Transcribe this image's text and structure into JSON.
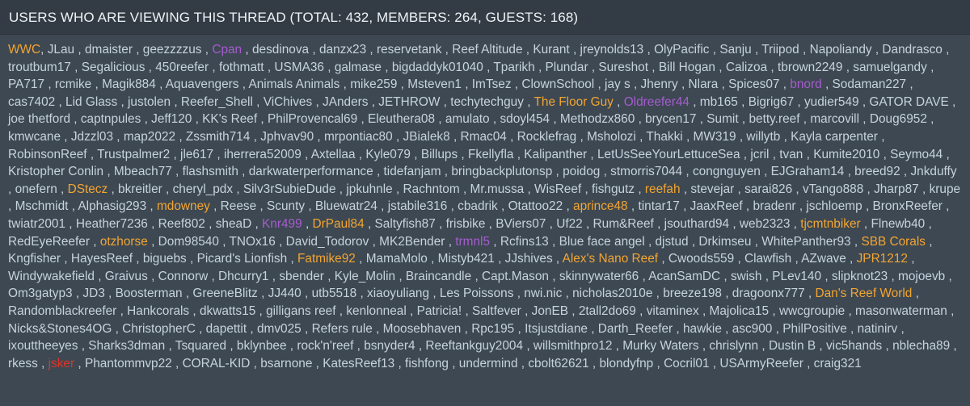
{
  "header": {
    "title": "USERS WHO ARE VIEWING THIS THREAD (TOTAL: 432, MEMBERS: 264, GUESTS: 168)"
  },
  "colors": {
    "default": "#c6d3dd",
    "orange": "#f3a532",
    "purple": "#a65ccf",
    "red": "#e0342a"
  },
  "users": [
    {
      "name": "WWC",
      "role": "orange"
    },
    {
      "name": "JLau"
    },
    {
      "name": "dmaister"
    },
    {
      "name": "geezzzzus"
    },
    {
      "name": "Cpan",
      "role": "purple"
    },
    {
      "name": "desdinova"
    },
    {
      "name": "danzx23"
    },
    {
      "name": "reservetank"
    },
    {
      "name": "Reef Altitude"
    },
    {
      "name": "Kurant"
    },
    {
      "name": "jreynolds13"
    },
    {
      "name": "OlyPacific"
    },
    {
      "name": "Sanju"
    },
    {
      "name": "Triipod"
    },
    {
      "name": "Napoliandy"
    },
    {
      "name": "Dandrasco"
    },
    {
      "name": "troutbum17"
    },
    {
      "name": "Segalicious"
    },
    {
      "name": "450reefer"
    },
    {
      "name": "fothmatt"
    },
    {
      "name": "USMA36"
    },
    {
      "name": "galmase"
    },
    {
      "name": "bigdaddyk01040"
    },
    {
      "name": "Tparikh"
    },
    {
      "name": "Plundar"
    },
    {
      "name": "Sureshot"
    },
    {
      "name": "Bill Hogan"
    },
    {
      "name": "Calizoa"
    },
    {
      "name": "tbrown2249"
    },
    {
      "name": "samuelgandy"
    },
    {
      "name": "PA717"
    },
    {
      "name": "rcmike"
    },
    {
      "name": "Magik884"
    },
    {
      "name": "Aquavengers"
    },
    {
      "name": "Animals Animals"
    },
    {
      "name": "mike259"
    },
    {
      "name": "Msteven1"
    },
    {
      "name": "ImTsez"
    },
    {
      "name": "ClownSchool"
    },
    {
      "name": "jay s"
    },
    {
      "name": "Jhenry"
    },
    {
      "name": "Nlara"
    },
    {
      "name": "Spices07"
    },
    {
      "name": "bnord",
      "role": "purple"
    },
    {
      "name": "Sodaman227"
    },
    {
      "name": "cas7402"
    },
    {
      "name": "Lid Glass"
    },
    {
      "name": "justolen"
    },
    {
      "name": "Reefer_Shell"
    },
    {
      "name": "ViChives"
    },
    {
      "name": "JAnders"
    },
    {
      "name": "JETHROW"
    },
    {
      "name": "techytechguy"
    },
    {
      "name": "The Floor Guy",
      "role": "orange"
    },
    {
      "name": "Oldreefer44",
      "role": "purple"
    },
    {
      "name": "mb165"
    },
    {
      "name": "Bigrig67"
    },
    {
      "name": "yudier549"
    },
    {
      "name": "GATOR DAVE"
    },
    {
      "name": "joe thetford"
    },
    {
      "name": "captnpules"
    },
    {
      "name": "Jeff120"
    },
    {
      "name": "KK's Reef"
    },
    {
      "name": "PhilProvencal69"
    },
    {
      "name": "Eleuthera08"
    },
    {
      "name": "amulato"
    },
    {
      "name": "sdoyl454"
    },
    {
      "name": "Methodzx860"
    },
    {
      "name": "brycen17"
    },
    {
      "name": "Sumit"
    },
    {
      "name": "betty.reef"
    },
    {
      "name": "marcovill"
    },
    {
      "name": "Doug6952"
    },
    {
      "name": "kmwcane"
    },
    {
      "name": "Jdzzl03"
    },
    {
      "name": "map2022"
    },
    {
      "name": "Zssmith714"
    },
    {
      "name": "Jphvav90"
    },
    {
      "name": "mrpontiac80"
    },
    {
      "name": "JBialek8"
    },
    {
      "name": "Rmac04"
    },
    {
      "name": "Rocklefrag"
    },
    {
      "name": "Msholozi"
    },
    {
      "name": "Thakki"
    },
    {
      "name": "MW319"
    },
    {
      "name": "willytb"
    },
    {
      "name": "Kayla carpenter"
    },
    {
      "name": "RobinsonReef"
    },
    {
      "name": "Trustpalmer2"
    },
    {
      "name": "jle617"
    },
    {
      "name": "iherrera52009"
    },
    {
      "name": "Axtellaa"
    },
    {
      "name": "Kyle079"
    },
    {
      "name": "Billups"
    },
    {
      "name": "Fkellyfla"
    },
    {
      "name": "Kalipanther"
    },
    {
      "name": "LetUsSeeYourLettuceSea"
    },
    {
      "name": "jcril"
    },
    {
      "name": "tvan"
    },
    {
      "name": "Kumite2010"
    },
    {
      "name": "Seymo44"
    },
    {
      "name": "Kristopher Conlin"
    },
    {
      "name": "Mbeach77"
    },
    {
      "name": "flashsmith"
    },
    {
      "name": "darkwaterperformance"
    },
    {
      "name": "tidefanjam"
    },
    {
      "name": "bringbackplutonsp"
    },
    {
      "name": "poidog"
    },
    {
      "name": "stmorris7044"
    },
    {
      "name": "congnguyen"
    },
    {
      "name": "EJGraham14"
    },
    {
      "name": "breed92"
    },
    {
      "name": "Jnkduffy"
    },
    {
      "name": "onefern"
    },
    {
      "name": "DStecz",
      "role": "orange"
    },
    {
      "name": "bkreitler"
    },
    {
      "name": "cheryl_pdx"
    },
    {
      "name": "Silv3rSubieDude"
    },
    {
      "name": "jpkuhnle"
    },
    {
      "name": "Rachntom"
    },
    {
      "name": "Mr.mussa"
    },
    {
      "name": "WisReef"
    },
    {
      "name": "fishgutz"
    },
    {
      "name": "reefah",
      "role": "orange"
    },
    {
      "name": "stevejar"
    },
    {
      "name": "sarai826"
    },
    {
      "name": "vTango888"
    },
    {
      "name": "Jharp87"
    },
    {
      "name": "krupe"
    },
    {
      "name": "Mschmidt"
    },
    {
      "name": "Alphasig293"
    },
    {
      "name": "mdowney",
      "role": "orange"
    },
    {
      "name": "Reese"
    },
    {
      "name": "Scunty"
    },
    {
      "name": "Bluewatr24"
    },
    {
      "name": "jstabile316"
    },
    {
      "name": "cbadrik"
    },
    {
      "name": "Otattoo22"
    },
    {
      "name": "aprince48",
      "role": "orange"
    },
    {
      "name": "tintar17"
    },
    {
      "name": "JaaxReef"
    },
    {
      "name": "bradenr"
    },
    {
      "name": "jschloemp"
    },
    {
      "name": "BronxReefer"
    },
    {
      "name": "twiatr2001"
    },
    {
      "name": "Heather7236"
    },
    {
      "name": "Reef802"
    },
    {
      "name": "sheaD"
    },
    {
      "name": "Knr499",
      "role": "purple"
    },
    {
      "name": "DrPaul84",
      "role": "orange"
    },
    {
      "name": "Saltyfish87"
    },
    {
      "name": "frisbike"
    },
    {
      "name": "BViers07"
    },
    {
      "name": "Uf22"
    },
    {
      "name": "Rum&Reef"
    },
    {
      "name": "jsouthard94"
    },
    {
      "name": "web2323"
    },
    {
      "name": "tjcmtnbiker",
      "role": "orange"
    },
    {
      "name": "Flnewb40"
    },
    {
      "name": "RedEyeReefer"
    },
    {
      "name": "otzhorse",
      "role": "orange"
    },
    {
      "name": "Dom98540"
    },
    {
      "name": "TNOx16"
    },
    {
      "name": "David_Todorov"
    },
    {
      "name": "MK2Bender"
    },
    {
      "name": "trmnl5",
      "role": "purple"
    },
    {
      "name": "Rcfins13"
    },
    {
      "name": "Blue face angel"
    },
    {
      "name": "djstud"
    },
    {
      "name": "Drkimseu"
    },
    {
      "name": "WhitePanther93"
    },
    {
      "name": "SBB Corals",
      "role": "orange"
    },
    {
      "name": "Kngfisher"
    },
    {
      "name": "HayesReef"
    },
    {
      "name": "biguebs"
    },
    {
      "name": "Picard's Lionfish"
    },
    {
      "name": "Fatmike92",
      "role": "orange"
    },
    {
      "name": "MamaMolo"
    },
    {
      "name": "Mistyb421"
    },
    {
      "name": "JJshives"
    },
    {
      "name": "Alex's Nano Reef",
      "role": "orange"
    },
    {
      "name": "Cwoods559"
    },
    {
      "name": "Clawfish"
    },
    {
      "name": "AZwave"
    },
    {
      "name": "JPR1212",
      "role": "orange"
    },
    {
      "name": "Windywakefield"
    },
    {
      "name": "Graivus"
    },
    {
      "name": "Connorw"
    },
    {
      "name": "Dhcurry1"
    },
    {
      "name": "sbender"
    },
    {
      "name": "Kyle_Molin"
    },
    {
      "name": "Braincandle"
    },
    {
      "name": "Capt.Mason"
    },
    {
      "name": "skinnywater66"
    },
    {
      "name": "AcanSamDC"
    },
    {
      "name": "swish"
    },
    {
      "name": "PLev140"
    },
    {
      "name": "slipknot23"
    },
    {
      "name": "mojoevb"
    },
    {
      "name": "Om3gatyp3"
    },
    {
      "name": "JD3"
    },
    {
      "name": "Boosterman"
    },
    {
      "name": "GreeneBlitz"
    },
    {
      "name": "JJ440"
    },
    {
      "name": "utb5518"
    },
    {
      "name": "xiaoyuliang"
    },
    {
      "name": "Les Poissons"
    },
    {
      "name": "nwi.nic"
    },
    {
      "name": "nicholas2010e"
    },
    {
      "name": "breeze198"
    },
    {
      "name": "dragoonx777"
    },
    {
      "name": "Dan's Reef World",
      "role": "orange"
    },
    {
      "name": "Randomblackreefer"
    },
    {
      "name": "Hankcorals"
    },
    {
      "name": "dkwatts15"
    },
    {
      "name": "gilligans reef"
    },
    {
      "name": "kenlonneal"
    },
    {
      "name": "Patricia!"
    },
    {
      "name": "Saltfever"
    },
    {
      "name": "JonEB"
    },
    {
      "name": "2tall2do69"
    },
    {
      "name": "vitaminex"
    },
    {
      "name": "Majolica15"
    },
    {
      "name": "wwcgroupie"
    },
    {
      "name": "masonwaterman"
    },
    {
      "name": "Nicks&Stones4OG"
    },
    {
      "name": "ChristopherC"
    },
    {
      "name": "dapettit"
    },
    {
      "name": "dmv025"
    },
    {
      "name": "Refers rule"
    },
    {
      "name": "Moosebhaven"
    },
    {
      "name": "Rpc195"
    },
    {
      "name": "Itsjustdiane"
    },
    {
      "name": "Darth_Reefer"
    },
    {
      "name": "hawkie"
    },
    {
      "name": "asc900"
    },
    {
      "name": "PhilPositive"
    },
    {
      "name": "natinirv"
    },
    {
      "name": "ixouttheeyes"
    },
    {
      "name": "Sharks3dman"
    },
    {
      "name": "Tsquared"
    },
    {
      "name": "bklynbee"
    },
    {
      "name": "rock'n'reef"
    },
    {
      "name": "bsnyder4"
    },
    {
      "name": "Reeftankguy2004"
    },
    {
      "name": "willsmithpro12"
    },
    {
      "name": "Murky Waters"
    },
    {
      "name": "chrislynn"
    },
    {
      "name": "Dustin B"
    },
    {
      "name": "vic5hands"
    },
    {
      "name": "nblecha89"
    },
    {
      "name": "rkess"
    },
    {
      "name": "jsker",
      "role": "red"
    },
    {
      "name": "Phantommvp22"
    },
    {
      "name": "CORAL-KID"
    },
    {
      "name": "bsarnone"
    },
    {
      "name": "KatesReef13"
    },
    {
      "name": "fishfong"
    },
    {
      "name": "undermind"
    },
    {
      "name": "cbolt62621"
    },
    {
      "name": "blondyfnp"
    },
    {
      "name": "Cocril01"
    },
    {
      "name": "USArmyReefer"
    },
    {
      "name": "craig321"
    }
  ]
}
